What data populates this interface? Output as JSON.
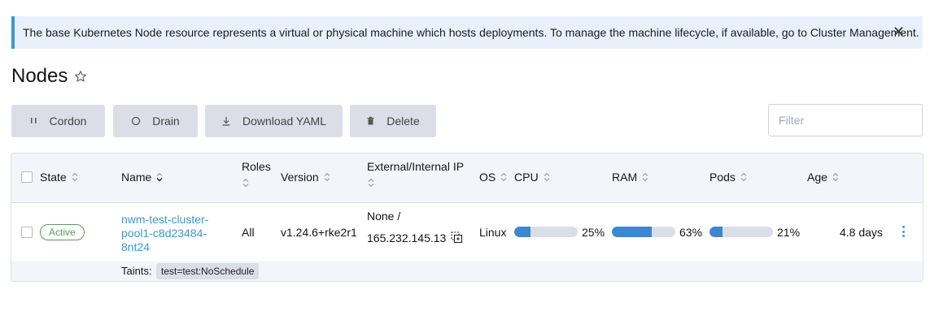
{
  "banner": {
    "text": "The base Kubernetes Node resource represents a virtual or physical machine which hosts deployments. To manage the machine lifecycle, if available, go to Cluster Management.",
    "close": "✕"
  },
  "page": {
    "title": "Nodes"
  },
  "actions": {
    "cordon": "Cordon",
    "drain": "Drain",
    "download": "Download YAML",
    "delete": "Delete"
  },
  "filter": {
    "placeholder": "Filter",
    "value": ""
  },
  "columns": {
    "state": "State",
    "name": "Name",
    "roles": "Roles",
    "version": "Version",
    "ip": "External/Internal IP",
    "os": "OS",
    "cpu": "CPU",
    "ram": "RAM",
    "pods": "Pods",
    "age": "Age"
  },
  "rows": [
    {
      "state": "Active",
      "name": [
        "nwm-test-cluster-",
        "pool1-c8d23484-",
        "8nt24"
      ],
      "roles": "All",
      "version": "v1.24.6+rke2r1",
      "external_ip": "None /",
      "internal_ip": "165.232.145.13",
      "os": "Linux",
      "cpu": {
        "label": "25%",
        "fraction": 0.25
      },
      "ram": {
        "label": "63%",
        "fraction": 0.63
      },
      "pods": {
        "label": "21%",
        "fraction": 0.21
      },
      "age": "4.8 days",
      "taints_label": "Taints:",
      "taint": "test=test:NoSchedule"
    }
  ],
  "colors": {
    "accent": "#3d98d3",
    "bar_fill": "#3d86d0",
    "bar_track": "#dcdee7",
    "active": "#5d995d",
    "banner_bg": "#e8f1fb"
  },
  "icons": {
    "star": "star-outline-icon",
    "cordon": "pause-icon",
    "drain": "circle-icon",
    "download": "download-icon",
    "delete": "trash-icon",
    "copy": "copy-icon",
    "menu": "kebab-menu-icon",
    "sort": "sort-icon"
  }
}
